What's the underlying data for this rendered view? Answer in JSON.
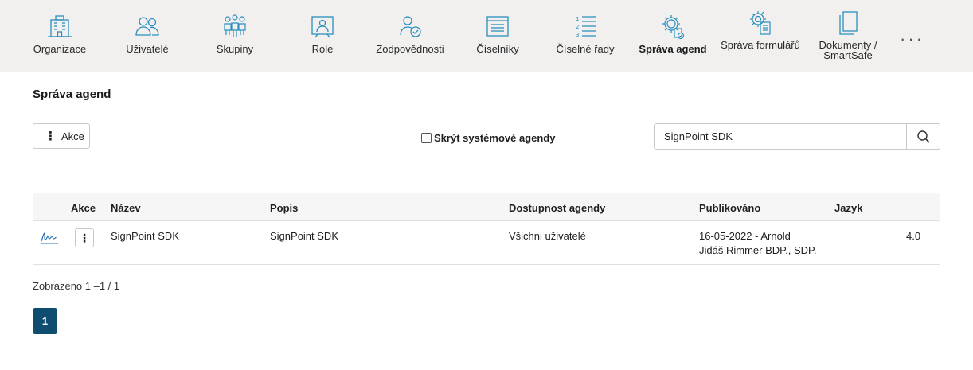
{
  "nav": {
    "items": [
      {
        "label": "Organizace"
      },
      {
        "label": "Uživatelé"
      },
      {
        "label": "Skupiny"
      },
      {
        "label": "Role"
      },
      {
        "label": "Zodpovědnosti"
      },
      {
        "label": "Číselníky"
      },
      {
        "label": "Číselné řady"
      },
      {
        "label": "Správa agend"
      },
      {
        "label": "Správa formulářů"
      },
      {
        "label": "Dokumenty / SmartSafe"
      }
    ],
    "more": "···",
    "active_index": 7,
    "icon_color": "#2a8fbf"
  },
  "page": {
    "title": "Správa agend"
  },
  "toolbar": {
    "akce_label": "Akce",
    "hide_system_label": "Skrýt systémové agendy",
    "hide_system_checked": false,
    "search_value": "SignPoint SDK"
  },
  "table": {
    "headers": {
      "akce": "Akce",
      "nazev": "Název",
      "popis": "Popis",
      "dostupnost": "Dostupnost agendy",
      "publikovano": "Publikováno",
      "jazyk": "Jazyk"
    },
    "rows": [
      {
        "icon": "signature-icon",
        "nazev": "SignPoint SDK",
        "popis": "SignPoint SDK",
        "dostupnost": "Všichni uživatelé",
        "publikovano_line1": "16-05-2022 - Arnold",
        "publikovano_line2": "Jidáš Rimmer BDP., SDP.",
        "jazyk": "4.0"
      }
    ]
  },
  "footer": {
    "count": "Zobrazeno 1  –1  / 1",
    "page": "1"
  },
  "colors": {
    "nav_bg": "#f1f0ef",
    "accent": "#0f4d70"
  }
}
